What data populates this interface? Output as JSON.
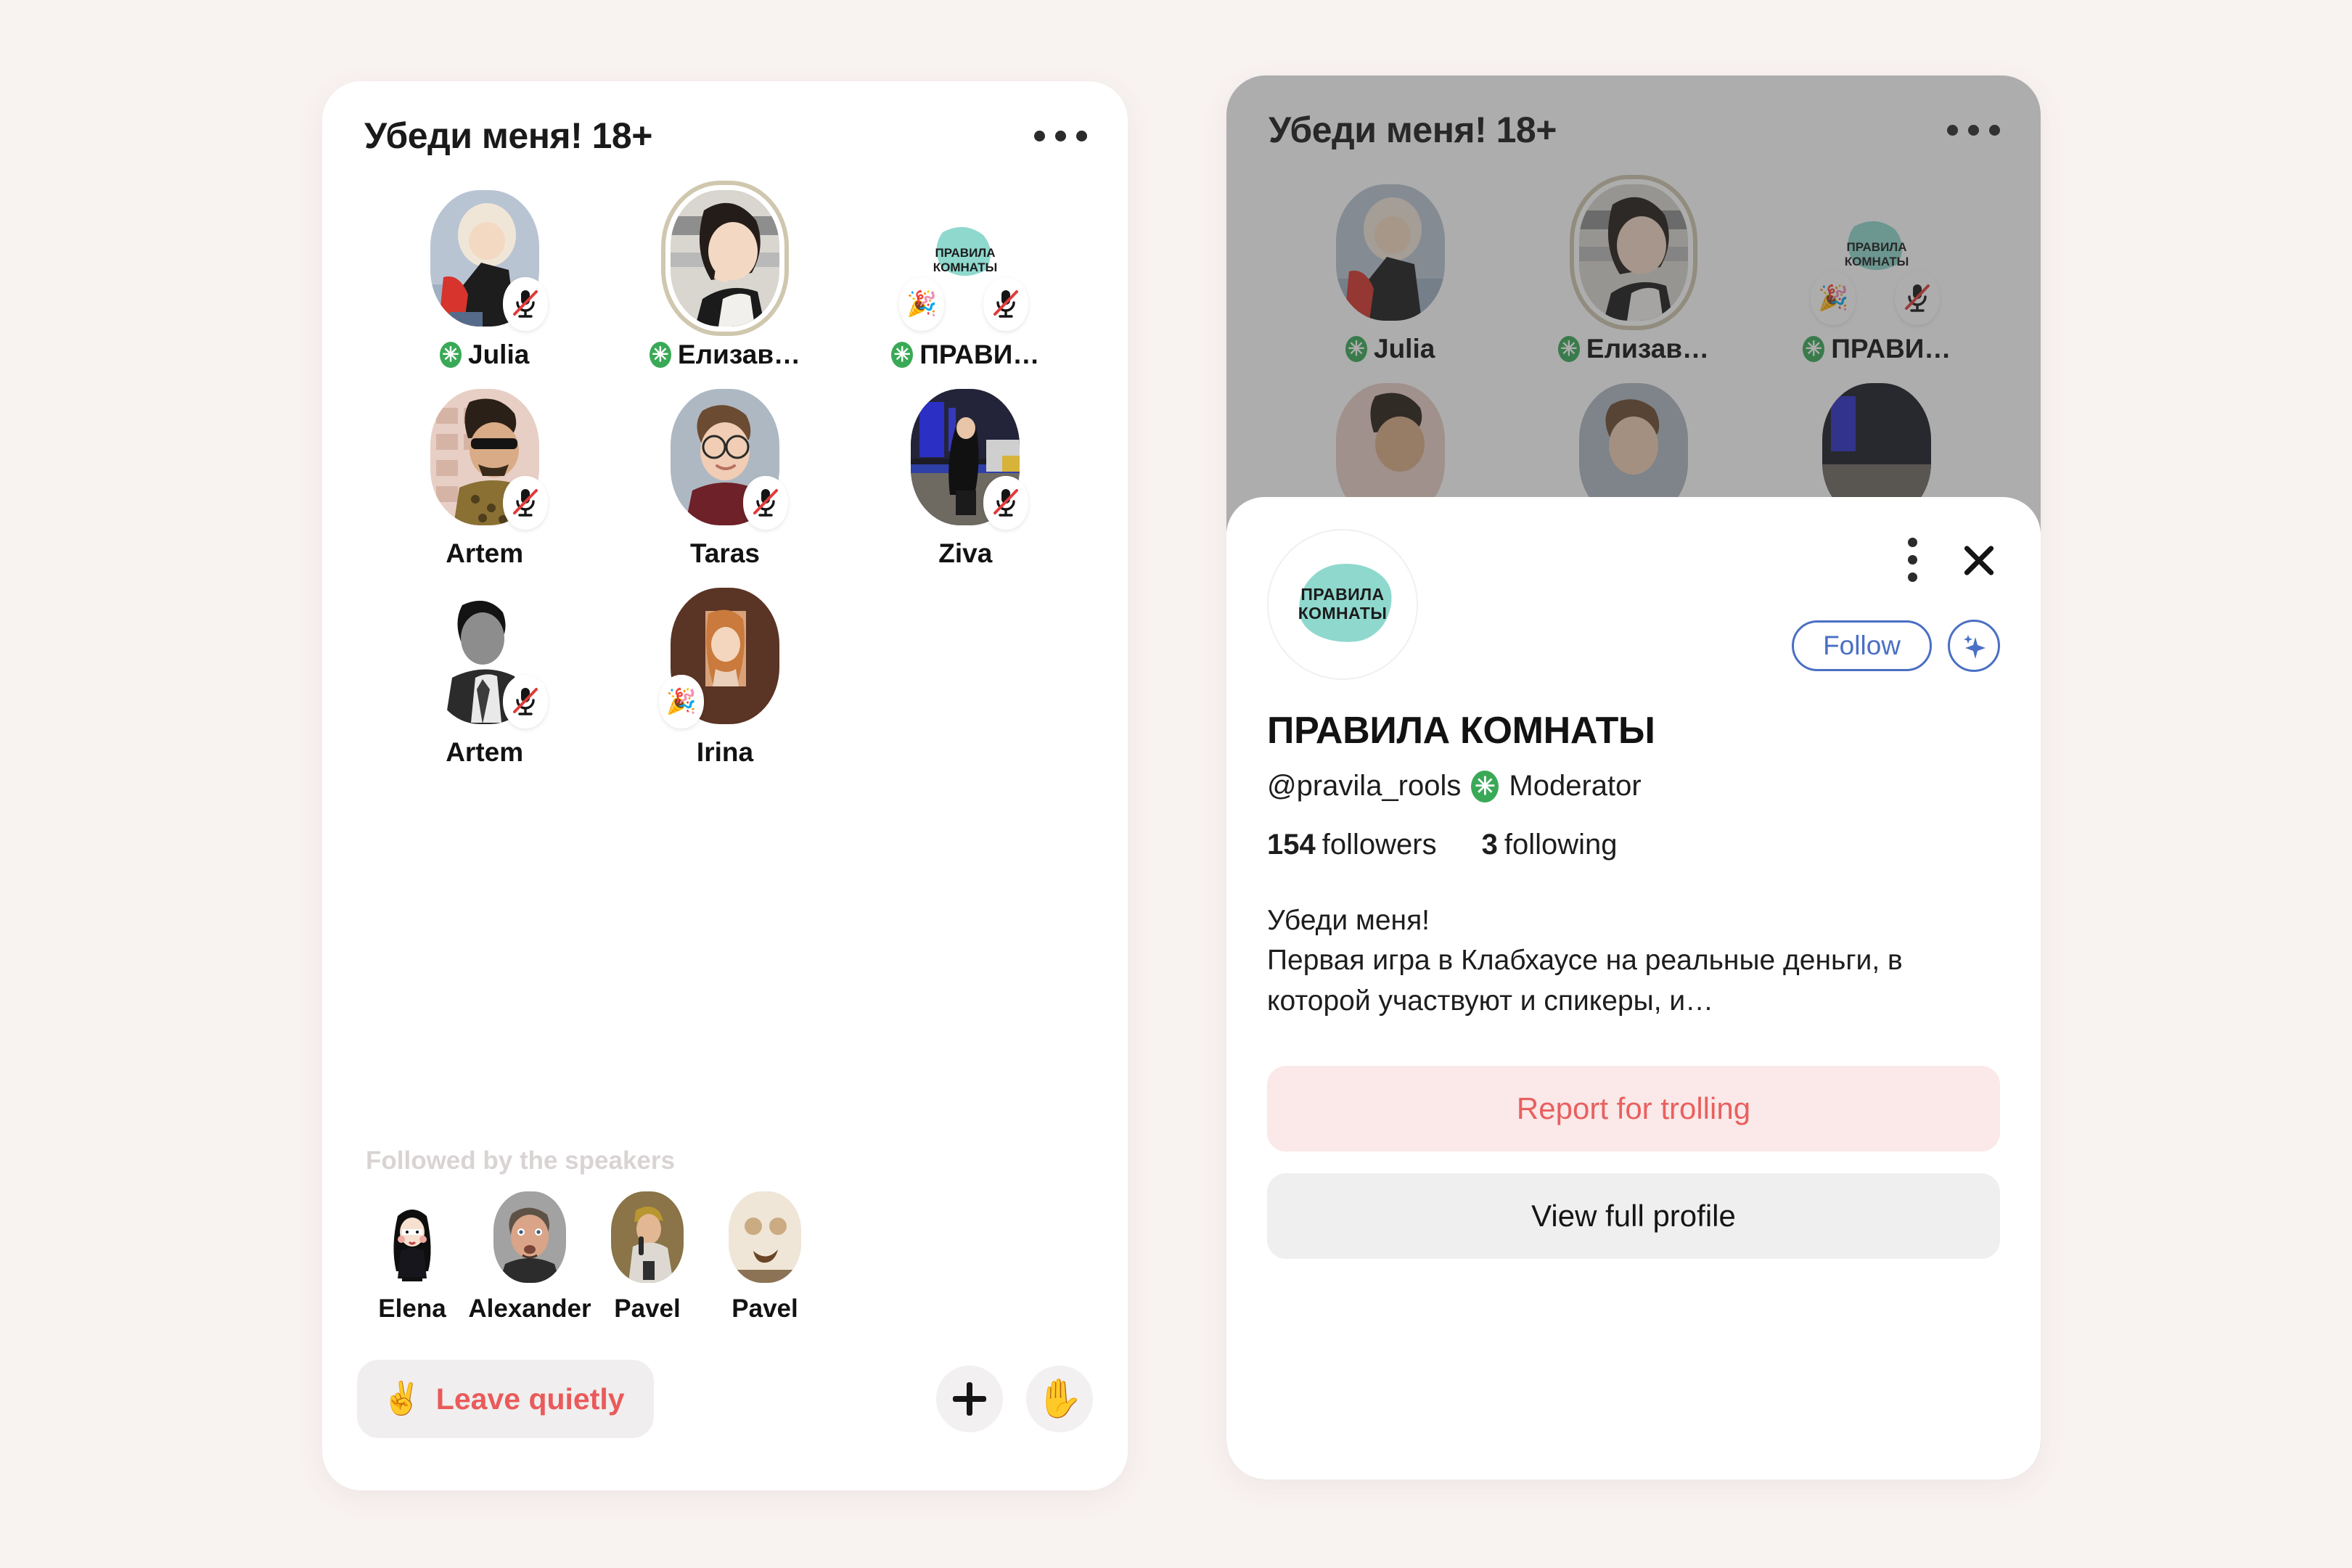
{
  "room": {
    "title": "Убеди меня! 18+",
    "more_icon": "ellipsis-horizontal-icon"
  },
  "speakers": [
    {
      "name": "Julia",
      "is_moderator": true,
      "badge": "✳",
      "status": "muted",
      "ring": false,
      "photo": "blonde-woman-red-backpack"
    },
    {
      "name": "Елизав…",
      "is_moderator": true,
      "badge": "✳",
      "status": "none",
      "ring": true,
      "photo": "dark-hair-woman-car"
    },
    {
      "name": "ПРАВИ…",
      "is_moderator": true,
      "badge": "✳",
      "status": "muted",
      "ring": false,
      "photo": "pravila-komnaty-logo",
      "extra_status": "party"
    },
    {
      "name": "Artem",
      "is_moderator": false,
      "badge": "",
      "status": "muted",
      "ring": false,
      "photo": "man-sunglasses-leopard"
    },
    {
      "name": "Taras",
      "is_moderator": false,
      "badge": "",
      "status": "muted",
      "ring": false,
      "photo": "man-glasses-maroon"
    },
    {
      "name": "Ziva",
      "is_moderator": false,
      "badge": "",
      "status": "muted",
      "ring": false,
      "photo": "woman-night-street"
    },
    {
      "name": "Artem",
      "is_moderator": false,
      "badge": "",
      "status": "muted",
      "ring": false,
      "photo": "man-bw-suit"
    },
    {
      "name": "Irina",
      "is_moderator": false,
      "badge": "",
      "status": "party",
      "ring": false,
      "photo": "redhead-woman-brown"
    }
  ],
  "followed": {
    "title": "Followed by the speakers",
    "people": [
      {
        "name": "Elena",
        "photo": "cartoon-girl-avatar"
      },
      {
        "name": "Alexander",
        "photo": "man-wide-eyes"
      },
      {
        "name": "Pavel",
        "photo": "man-cap-microphone"
      },
      {
        "name": "Pavel",
        "photo": "coffee-face"
      }
    ]
  },
  "bottom_bar": {
    "leave_emoji": "✌️",
    "leave_label": "Leave quietly",
    "add_icon": "plus-icon",
    "raise_hand_icon": "✋"
  },
  "profile_sheet": {
    "avatar_text_line1": "ПРАВИЛА",
    "avatar_text_line2": "КОМНАТЫ",
    "menu_icon": "kebab-vertical-icon",
    "close_icon": "close-icon",
    "follow_label": "Follow",
    "sparkle_icon": "sparkle-icon",
    "display_name": "ПРАВИЛА КОМНАТЫ",
    "handle": "@pravila_rools",
    "role_badge": "✳",
    "role": "Moderator",
    "followers_count": "154",
    "followers_label": "followers",
    "following_count": "3",
    "following_label": "following",
    "bio_line1": "Убеди меня!",
    "bio_line2": "Первая игра в Клабхаусе на реальные деньги, в которой участвуют и спикеры, и…",
    "report_label": "Report for trolling",
    "view_profile_label": "View full profile"
  },
  "colors": {
    "page_bg": "#f8f2f1",
    "accent_red": "#ea5a5a",
    "accent_blue": "#4a6fc4",
    "moderator_green": "#3aa957",
    "brand_mint": "#8fd8cd"
  }
}
